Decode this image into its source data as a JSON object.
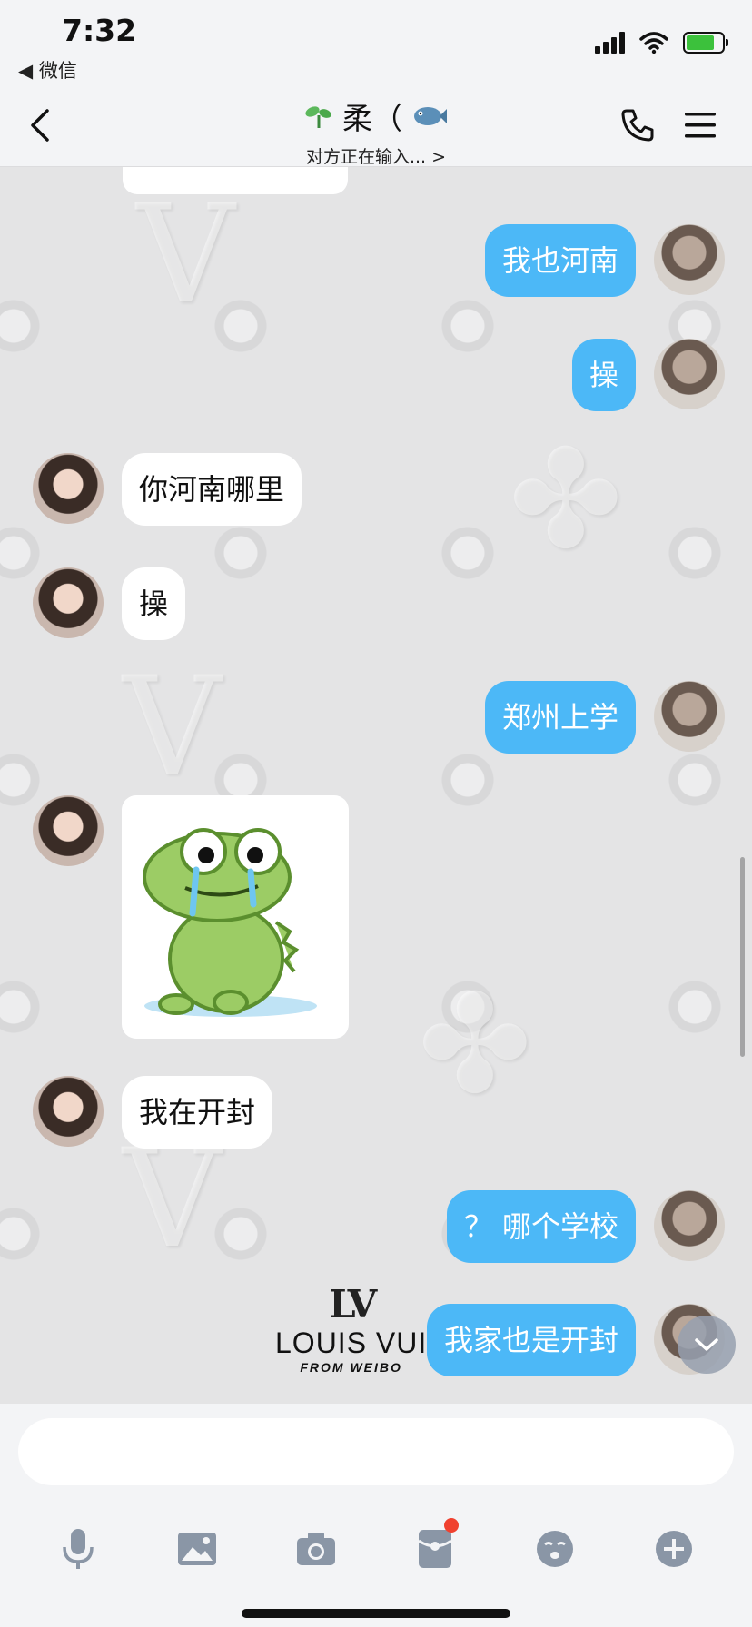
{
  "status_bar": {
    "time": "7:32",
    "back_app_label": "◀ 微信",
    "icons": [
      "cellular-signal-icon",
      "wifi-icon",
      "battery-charging-icon"
    ]
  },
  "nav": {
    "back_icon": "chevron-left-icon",
    "contact_name": "柔（",
    "name_prefix_icon": "sprout-icon",
    "name_suffix_icon": "fish-emoji-icon",
    "status": "对方正在输入... >",
    "call_icon": "phone-icon",
    "menu_icon": "hamburger-menu-icon"
  },
  "messages": [
    {
      "side": "out",
      "type": "text",
      "text": "我也河南"
    },
    {
      "side": "out",
      "type": "text",
      "text": "操"
    },
    {
      "side": "in",
      "type": "text",
      "text": "你河南哪里"
    },
    {
      "side": "in",
      "type": "text",
      "text": "操"
    },
    {
      "side": "out",
      "type": "text",
      "text": "郑州上学"
    },
    {
      "side": "in",
      "type": "sticker",
      "sticker": "crying-frog-sticker"
    },
    {
      "side": "in",
      "type": "text",
      "text": "我在开封"
    },
    {
      "side": "out",
      "type": "text",
      "text": "？ 哪个学校"
    },
    {
      "side": "out",
      "type": "text",
      "text": "我家也是开封"
    }
  ],
  "wallpaper": {
    "logo_text": "LOUIS VUI",
    "logo_sub": "FROM WEIBO"
  },
  "input": {
    "value": "",
    "placeholder": ""
  },
  "toolbar": {
    "items": [
      "microphone-icon",
      "image-icon",
      "camera-icon",
      "red-packet-icon",
      "emoji-icon",
      "plus-icon"
    ],
    "red_packet_badge": true
  },
  "colors": {
    "outgoing_bubble": "#4cb8f7",
    "incoming_bubble": "#ffffff",
    "badge": "#f0412f",
    "bar_background": "#f3f4f6"
  }
}
